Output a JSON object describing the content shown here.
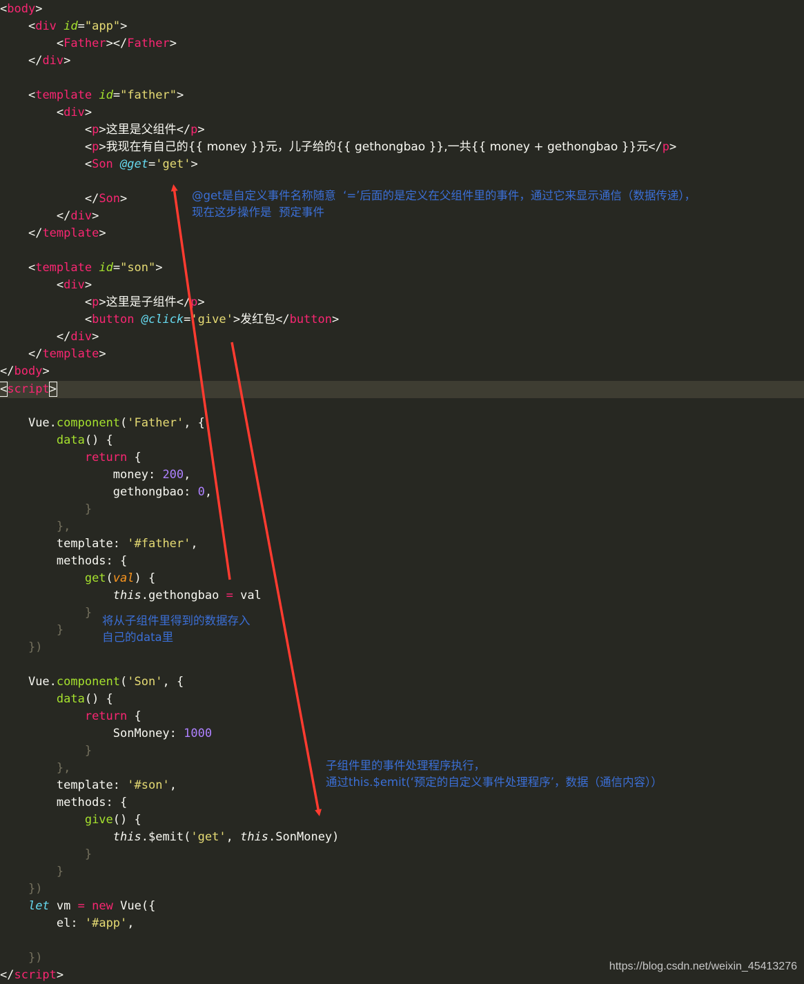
{
  "code": {
    "l1": "body",
    "l2_tag": "div",
    "l2_attr": "id",
    "l2_val": "\"app\"",
    "l3_tag": "Father",
    "l4_tag": "div",
    "l6_tag": "template",
    "l6_attr": "id",
    "l6_val": "\"father\"",
    "l7_tag": "div",
    "l8_tag": "p",
    "l8_text": "这里是父组件",
    "l9_tag": "p",
    "l9_text": "我现在有自己的{{ money }}元，儿子给的{{ gethongbao }},一共{{ money + gethongbao }}元",
    "l10_tag": "Son",
    "l10_attr": "@get",
    "l10_val": "'get'",
    "l12_tag": "Son",
    "l13_tag": "div",
    "l14_tag": "template",
    "l16_tag": "template",
    "l16_attr": "id",
    "l16_val": "\"son\"",
    "l17_tag": "div",
    "l18_tag": "p",
    "l18_text": "这里是子组件",
    "l19_tag": "button",
    "l19_attr": "@click",
    "l19_val": "'give'",
    "l19_text": "发红包",
    "l20_tag": "div",
    "l21_tag": "template",
    "l22_tag": "body",
    "l23_tag": "script",
    "vue": "Vue",
    "component": "component",
    "father_name": "'Father'",
    "data_fn": "data",
    "return_kw": "return",
    "money_key": "money",
    "money_val": "200",
    "geth_key": "gethongbao",
    "geth_val": "0",
    "template_key": "template",
    "father_tpl": "'#father'",
    "methods_key": "methods",
    "get_fn": "get",
    "val_param": "val",
    "this_kw": "this",
    "geth_prop": "gethongbao",
    "val_ref": "val",
    "son_name": "'Son'",
    "sonmoney_key": "SonMoney",
    "sonmoney_val": "1000",
    "son_tpl": "'#son'",
    "give_fn": "give",
    "emit_fn": "$emit",
    "emit_arg": "'get'",
    "sonmoney_prop": "SonMoney",
    "let_kw": "let",
    "vm_var": "vm",
    "new_kw": "new",
    "el_key": "el",
    "app_sel": "'#app'",
    "script_close": "script"
  },
  "notes": {
    "n1_a": "@get是自定义事件名称随意  ‘=’后面的是定义在父组件里的事件，通过它来显示通信（数据传递），",
    "n1_b": "现在这步操作是  预定事件",
    "n2_a": "将从子组件里得到的数据存入",
    "n2_b": "自己的data里",
    "n3_a": "子组件里的事件处理程序执行，",
    "n3_b": "通过this.$emit(‘预定的自定义事件处理程序’，数据（通信内容））"
  },
  "watermark": "https://blog.csdn.net/weixin_45413276",
  "colors": {
    "background": "#272822",
    "annotation": "#3b6fd6",
    "arrow": "#ff3b30"
  }
}
